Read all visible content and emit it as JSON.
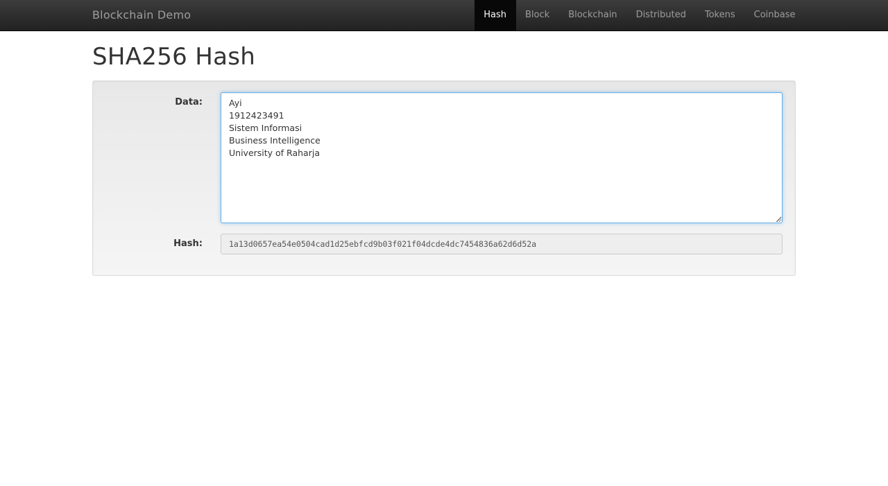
{
  "navbar": {
    "brand": "Blockchain Demo",
    "items": [
      {
        "label": "Hash",
        "active": true
      },
      {
        "label": "Block",
        "active": false
      },
      {
        "label": "Blockchain",
        "active": false
      },
      {
        "label": "Distributed",
        "active": false
      },
      {
        "label": "Tokens",
        "active": false
      },
      {
        "label": "Coinbase",
        "active": false
      }
    ]
  },
  "page": {
    "title": "SHA256 Hash"
  },
  "form": {
    "data_label": "Data:",
    "data_value": "Ayi\n1912423491\nSistem Informasi\nBusiness Intelligence\nUniversity of Raharja",
    "hash_label": "Hash:",
    "hash_value": "1a13d0657ea54e0504cad1d25ebfcd9b03f021f04dcde4dc7454836a62d6d52a"
  },
  "colors": {
    "navbar_bg": "#222222",
    "active_tab_bg": "#080808",
    "focus_border": "#66afe9"
  }
}
